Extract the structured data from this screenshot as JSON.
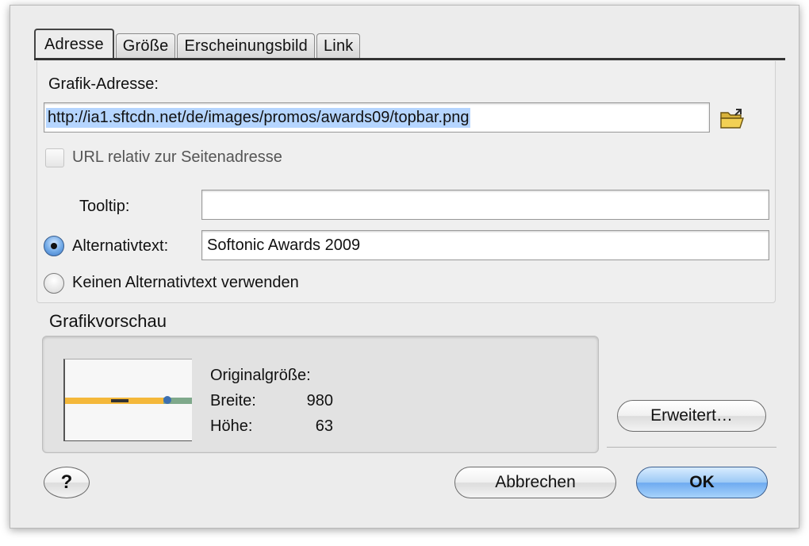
{
  "tabs": [
    {
      "label": "Adresse",
      "active": true
    },
    {
      "label": "Größe",
      "active": false
    },
    {
      "label": "Erscheinungsbild",
      "active": false
    },
    {
      "label": "Link",
      "active": false
    }
  ],
  "address": {
    "image_address_label": "Grafik-Adresse:",
    "image_address_value": "http://ia1.sftcdn.net/de/images/promos/awards09/topbar.png",
    "relative_url_label": "URL relativ zur Seitenadresse",
    "relative_url_checked": false,
    "tooltip_label": "Tooltip:",
    "tooltip_value": "",
    "alt_text_label": "Alternativtext:",
    "alt_text_value": "Softonic Awards 2009",
    "alt_text_selected": true,
    "no_alt_text_label": "Keinen Alternativtext verwenden"
  },
  "preview": {
    "heading": "Grafikvorschau",
    "original_size_label": "Originalgröße:",
    "width_label": "Breite:",
    "width_value": "980",
    "height_label": "Höhe:",
    "height_value": "63"
  },
  "buttons": {
    "advanced": "Erweitert…",
    "help": "?",
    "cancel": "Abbrechen",
    "ok": "OK"
  },
  "colors": {
    "dialog_bg": "#ececec",
    "selection": "#b5d5ff",
    "default_button": "#6eaaf0"
  },
  "icons": {
    "browse": "folder-open-icon"
  }
}
